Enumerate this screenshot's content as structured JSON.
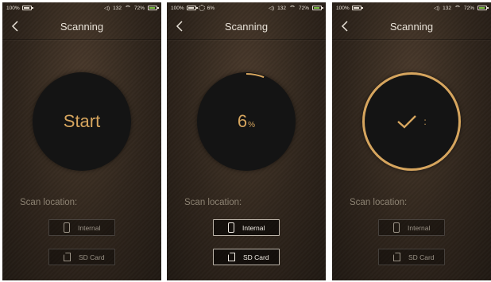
{
  "screens": [
    {
      "status": {
        "battery": "100%",
        "signal": "132",
        "wifi_battery": "72%",
        "indicator": ""
      },
      "title": "Scanning",
      "state": "start",
      "center_text": "Start",
      "scan_label": "Scan location:",
      "buttons": {
        "internal": "Internal",
        "sd": "SD Card"
      }
    },
    {
      "status": {
        "battery": "100%",
        "signal": "132",
        "wifi_battery": "72%",
        "indicator": "6%"
      },
      "title": "Scanning",
      "state": "progress",
      "progress_value": "6",
      "progress_unit": "%",
      "progress_fraction": 0.06,
      "scan_label": "Scan location:",
      "buttons": {
        "internal": "Internal",
        "sd": "SD Card"
      }
    },
    {
      "status": {
        "battery": "100%",
        "signal": "132",
        "wifi_battery": "72%",
        "indicator": ""
      },
      "title": "Scanning",
      "state": "done",
      "done_mark": ":",
      "scan_label": "Scan location:",
      "buttons": {
        "internal": "Internal",
        "sd": "SD Card"
      }
    }
  ],
  "colors": {
    "accent": "#d6a55e",
    "battery_green": "#7bc142"
  }
}
